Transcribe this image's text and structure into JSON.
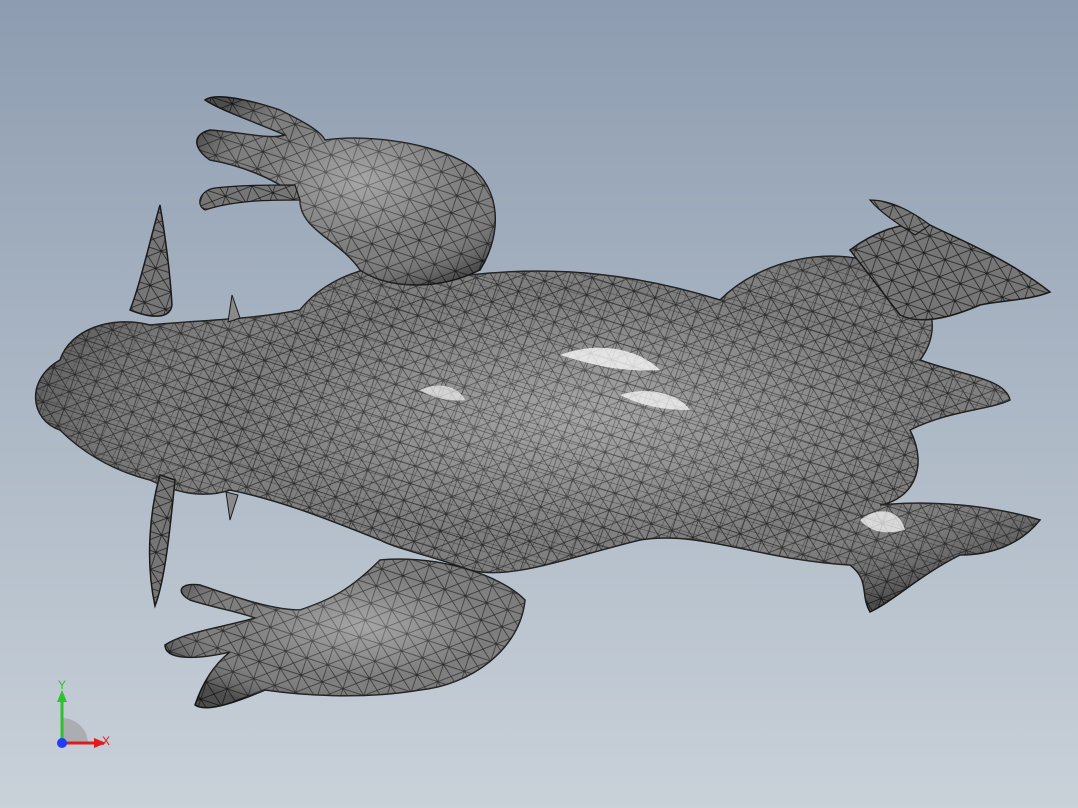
{
  "viewport": {
    "background_top": "#8d9cb0",
    "background_bottom": "#c9d1d9"
  },
  "model": {
    "render_style": "shaded-with-edges",
    "surface_color": "#6f6f6f",
    "edge_color": "#1a1a1a"
  },
  "triad": {
    "x_label": "X",
    "y_label": "Y",
    "x_color": "#e01b1b",
    "y_color": "#2fbf2f",
    "z_color": "#1f3cff"
  }
}
